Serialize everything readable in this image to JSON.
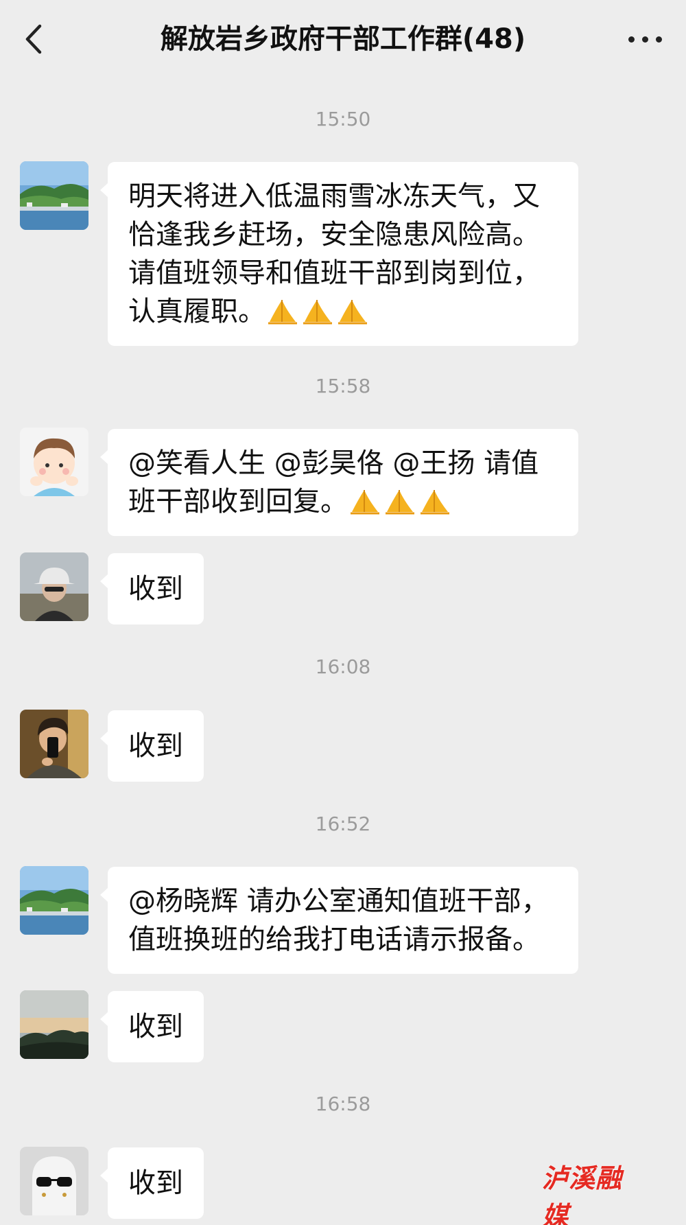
{
  "header": {
    "title": "解放岩乡政府干部工作群(48)",
    "back_icon": "chevron-left-icon",
    "more_icon": "more-dots-icon"
  },
  "messages": [
    {
      "time": "15:50"
    },
    {
      "avatar": "landscape-village-avatar",
      "text": "明天将进入低温雨雪冰冻天气，又恰逢我乡赶场，安全隐患风险高。请值班领导和值班干部到岗到位，认真履职。",
      "emoji": "pray-hands x3"
    },
    {
      "time": "15:58"
    },
    {
      "avatar": "cartoon-child-avatar",
      "text": "@笑看人生 @彭昊佫 @王扬  请值班干部收到回复。",
      "emoji": "pray-hands x3"
    },
    {
      "avatar": "person-with-hat-avatar",
      "text": "收到"
    },
    {
      "time": "16:08"
    },
    {
      "avatar": "selfie-phone-avatar",
      "text": "收到"
    },
    {
      "time": "16:52"
    },
    {
      "avatar": "landscape-village-avatar",
      "text": "@杨晓辉  请办公室通知值班干部，值班换班的给我打电话请示报备。"
    },
    {
      "avatar": "sunset-hills-avatar",
      "text": "收到"
    },
    {
      "time": "16:58"
    },
    {
      "avatar": "ghost-sunglasses-avatar",
      "text": "收到"
    }
  ],
  "watermark": {
    "text": "泸溪融媒",
    "color": "#e52a22"
  },
  "colors": {
    "background": "#ededed",
    "bubble": "#ffffff",
    "timestamp": "#9b9b9b"
  }
}
